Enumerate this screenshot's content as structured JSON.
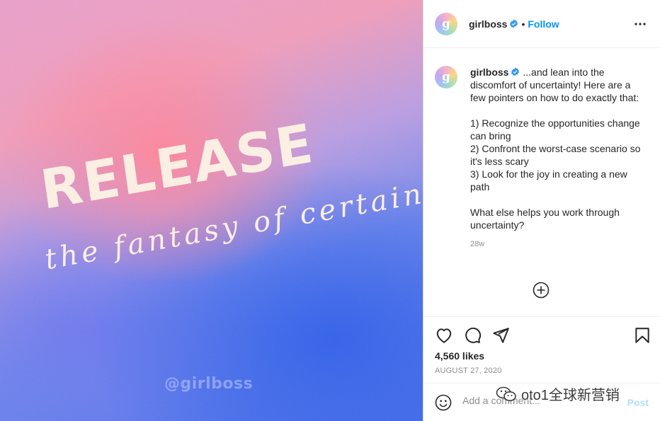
{
  "image": {
    "headline": "RELEASE",
    "subline": "the fantasy of certainty",
    "watermark_handle": "@girlboss"
  },
  "header": {
    "username": "girlboss",
    "avatar_letter": "g",
    "separator": "•",
    "follow_label": "Follow",
    "more_icon": "more-horizontal-icon"
  },
  "caption": {
    "username": "girlboss",
    "text": " ...and lean into the discomfort of uncertainty! Here are a few pointers on how to do exactly that:\n\n1) Recognize the opportunities change can bring\n2) Confront the worst-case scenario so it's less scary\n3) Look for the joy in creating a new path\n\nWhat else helps you work through uncertainty?",
    "time_ago": "28w"
  },
  "actions": {
    "like_icon": "heart-icon",
    "comment_icon": "comment-icon",
    "share_icon": "paper-plane-icon",
    "save_icon": "bookmark-icon"
  },
  "likes": "4,560 likes",
  "date": "AUGUST 27, 2020",
  "comment": {
    "placeholder": "Add a comment...",
    "post_label": "Post"
  },
  "overlay_watermark": "oto1全球新营销",
  "colors": {
    "accent": "#0095f6",
    "post_disabled": "#b2dffc",
    "muted": "#8e8e8e"
  }
}
